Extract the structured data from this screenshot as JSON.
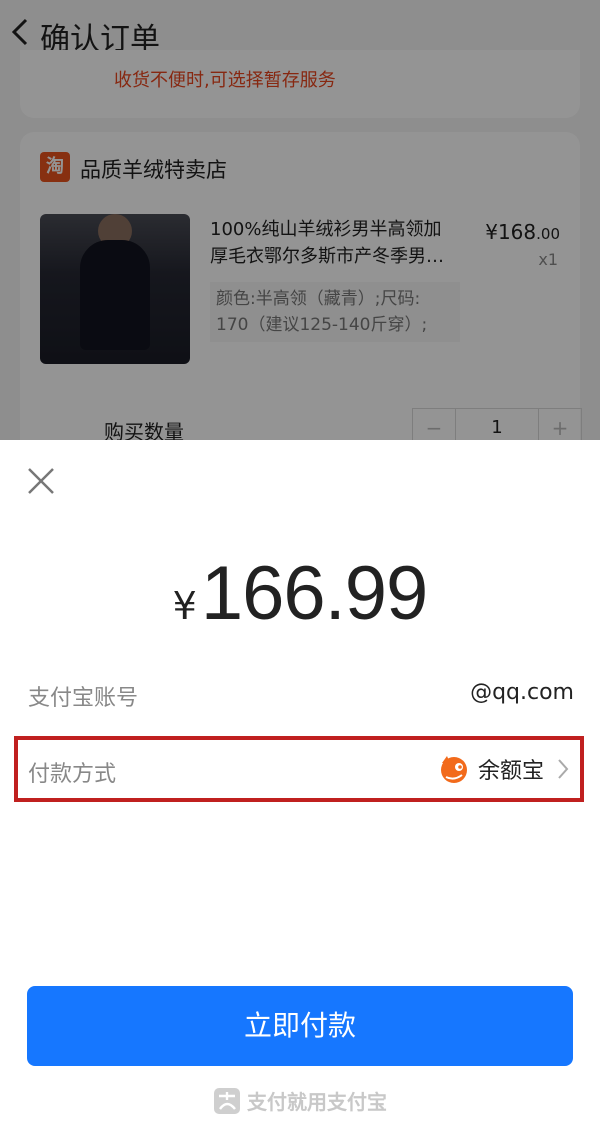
{
  "background": {
    "nav_title": "确认订单",
    "notice": "收货不便时,可选择暂存服务",
    "shop": {
      "logo_text": "淘",
      "name": "品质羊绒特卖店"
    },
    "product": {
      "title_line1": "100%纯山羊绒衫男半高领加",
      "title_line2": "厚毛衣鄂尔多斯市产冬季男…",
      "spec_line1": "颜色:半高领（藏青）;尺码:",
      "spec_line2": "170（建议125-140斤穿）;",
      "price_currency": "¥",
      "price_integer": "168",
      "price_decimal": ".00",
      "quantity": "x1"
    },
    "purchase_qty": {
      "label": "购买数量",
      "minus": "−",
      "value": "1",
      "plus": "+"
    }
  },
  "sheet": {
    "amount_currency": "¥",
    "amount_value": "166.99",
    "account_label": "支付宝账号",
    "account_value": "@qq.com",
    "method_label": "付款方式",
    "method_value": "余额宝",
    "method_icon": "yuebao-icon",
    "pay_button": "立即付款",
    "footer": "支付就用支付宝"
  },
  "colors": {
    "primary": "#1677ff",
    "highlight_border": "#c0201f",
    "notice": "#e8451e",
    "shop_logo": "#e8541e"
  }
}
